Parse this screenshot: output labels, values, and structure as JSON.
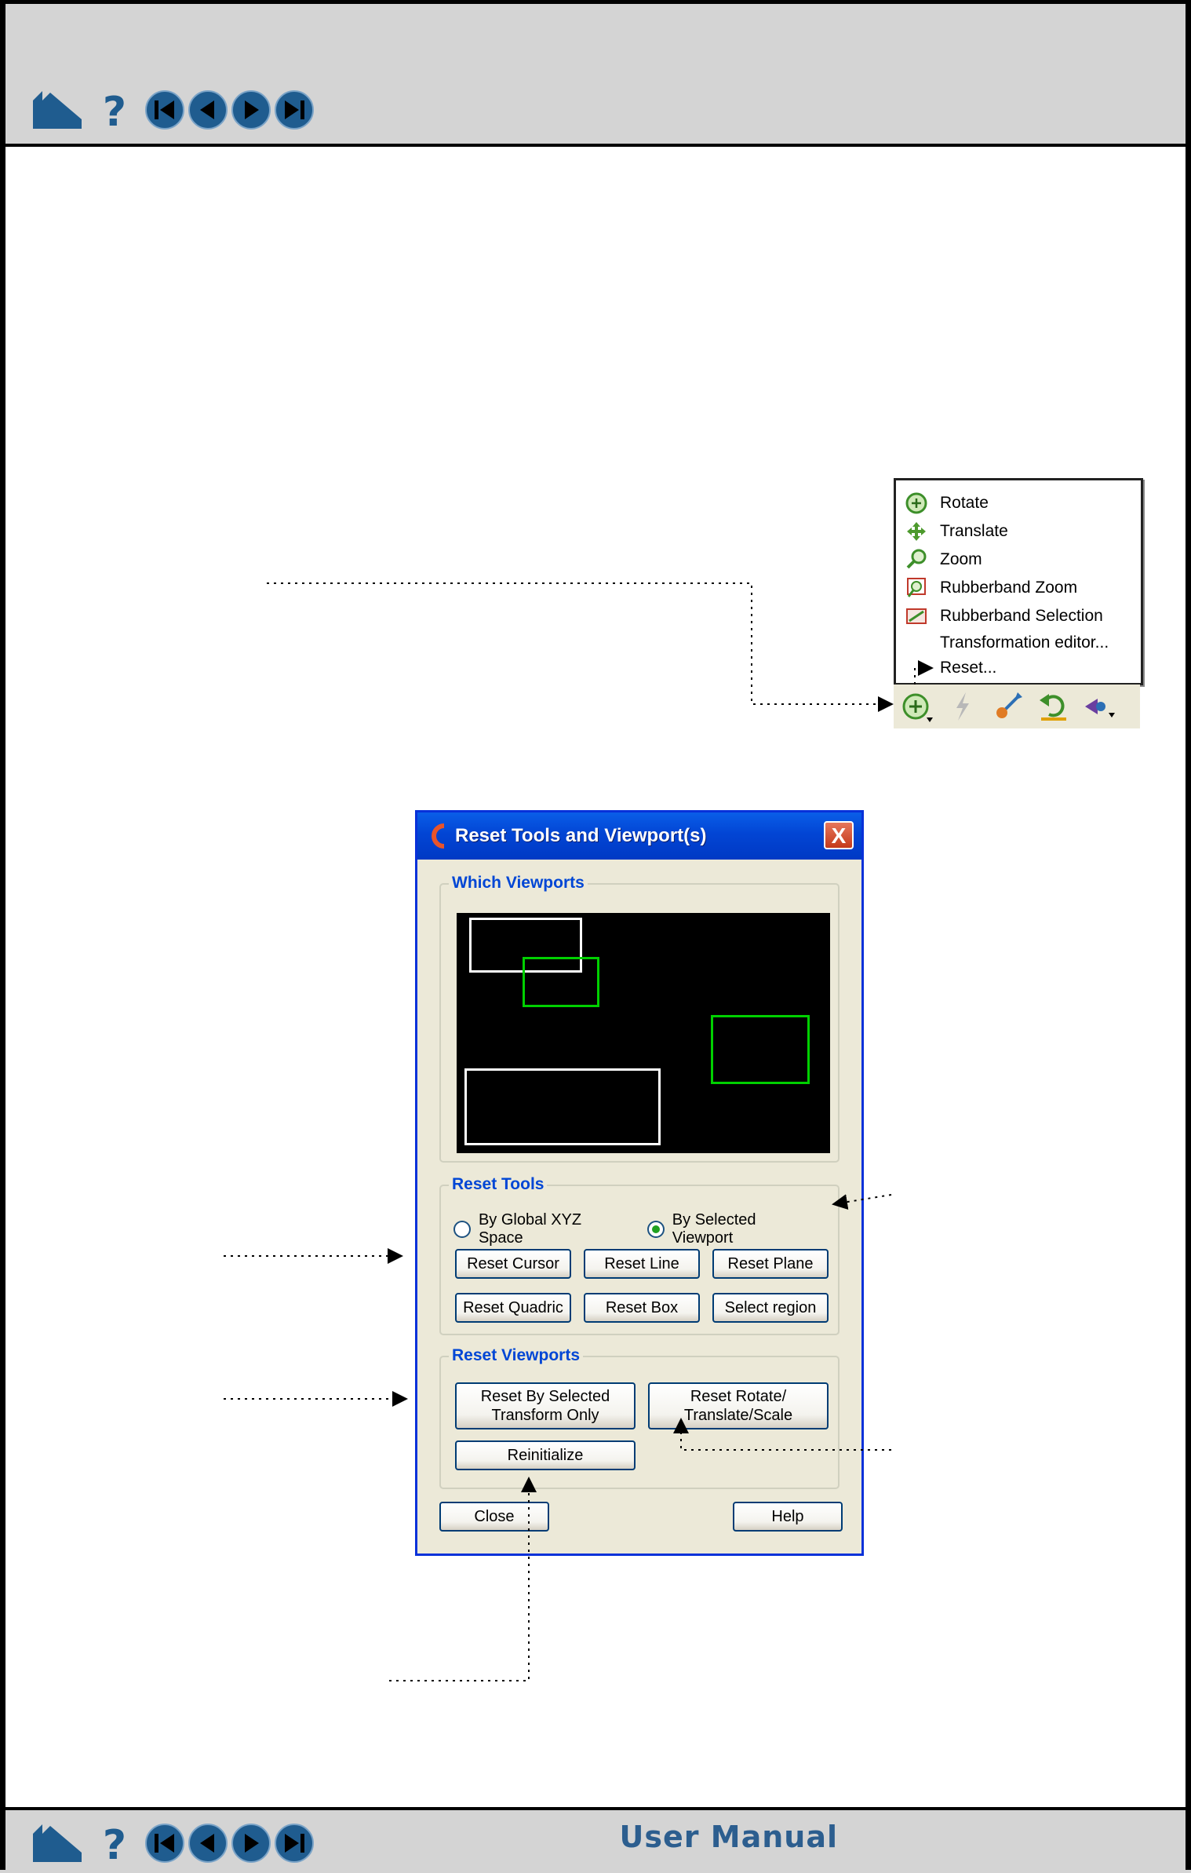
{
  "footer": {
    "title": "User Manual"
  },
  "nav": {
    "icons": [
      "home-icon",
      "help-icon",
      "first-page-icon",
      "previous-page-icon",
      "next-page-icon",
      "last-page-icon"
    ],
    "accent_color": "#1f5c8f"
  },
  "context_menu": {
    "items": [
      {
        "label": "Rotate",
        "icon": "rotate-icon"
      },
      {
        "label": "Translate",
        "icon": "translate-icon"
      },
      {
        "label": "Zoom",
        "icon": "zoom-icon"
      },
      {
        "label": "Rubberband Zoom",
        "icon": "rubberband-zoom-icon"
      },
      {
        "label": "Rubberband Selection",
        "icon": "rubberband-selection-icon"
      },
      {
        "label": "Transformation editor..."
      },
      {
        "label": "Reset..."
      }
    ]
  },
  "toolbar": {
    "icons": [
      "rotate-tool-icon",
      "lightning-icon",
      "scale-tool-icon",
      "undo-transform-icon",
      "view-selector-icon"
    ]
  },
  "dialog": {
    "title": "Reset Tools and Viewport(s)",
    "close_label": "X",
    "which_viewports": {
      "label": "Which Viewports",
      "viewports": [
        {
          "id": "vp1",
          "color": "#ffffff"
        },
        {
          "id": "vp2",
          "color": "#00d000"
        },
        {
          "id": "vp3",
          "color": "#00d000"
        },
        {
          "id": "vp4",
          "color": "#ffffff"
        }
      ]
    },
    "reset_tools": {
      "label": "Reset Tools",
      "radio_global": "By Global XYZ Space",
      "radio_selected": "By Selected Viewport",
      "selected_option": "By Selected Viewport",
      "buttons": [
        "Reset Cursor",
        "Reset Line",
        "Reset Plane",
        "Reset Quadric",
        "Reset Box",
        "Select region"
      ]
    },
    "reset_viewports": {
      "label": "Reset Viewports",
      "by_selected": "Reset By Selected Transform Only",
      "rotate_translate_scale": "Reset Rotate/ Translate/Scale",
      "reinitialize": "Reinitialize"
    },
    "close_button": "Close",
    "help_button": "Help"
  }
}
